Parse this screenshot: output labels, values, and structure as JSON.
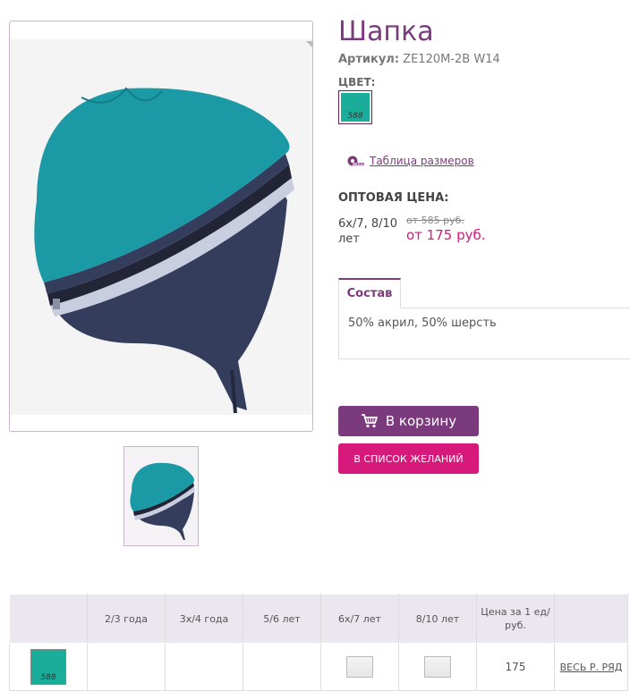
{
  "product": {
    "title": "Шапка",
    "sku_label": "Артикул:",
    "sku_value": "ZE120M-2B W14",
    "color_label": "ЦВЕТ:",
    "color_code": "588",
    "color_hex": "#1aae9a"
  },
  "links": {
    "size_table": "Таблица размеров"
  },
  "pricing": {
    "label": "ОПТОВАЯ ЦЕНА:",
    "sizes": "6х/7, 8/10 лет",
    "old_price": "от 585 руб.",
    "new_price": "от 175 руб."
  },
  "tabs": [
    {
      "label": "Состав",
      "content": "50% акрил, 50% шерсть"
    }
  ],
  "buttons": {
    "cart": "В корзину",
    "wishlist": "В СПИСОК ЖЕЛАНИЙ"
  },
  "grid": {
    "headers": [
      "",
      "2/3 года",
      "3х/4 года",
      "5/6 лет",
      "6х/7 лет",
      "8/10 лет",
      "Цена за 1 ед/ руб.",
      ""
    ],
    "row": {
      "swatch_code": "588",
      "price": "175",
      "link": "ВЕСЬ Р. РЯД"
    }
  },
  "colors": {
    "brand_purple": "#7a3a7c",
    "accent_pink": "#d6197a",
    "swatch_teal": "#1aae9a"
  }
}
